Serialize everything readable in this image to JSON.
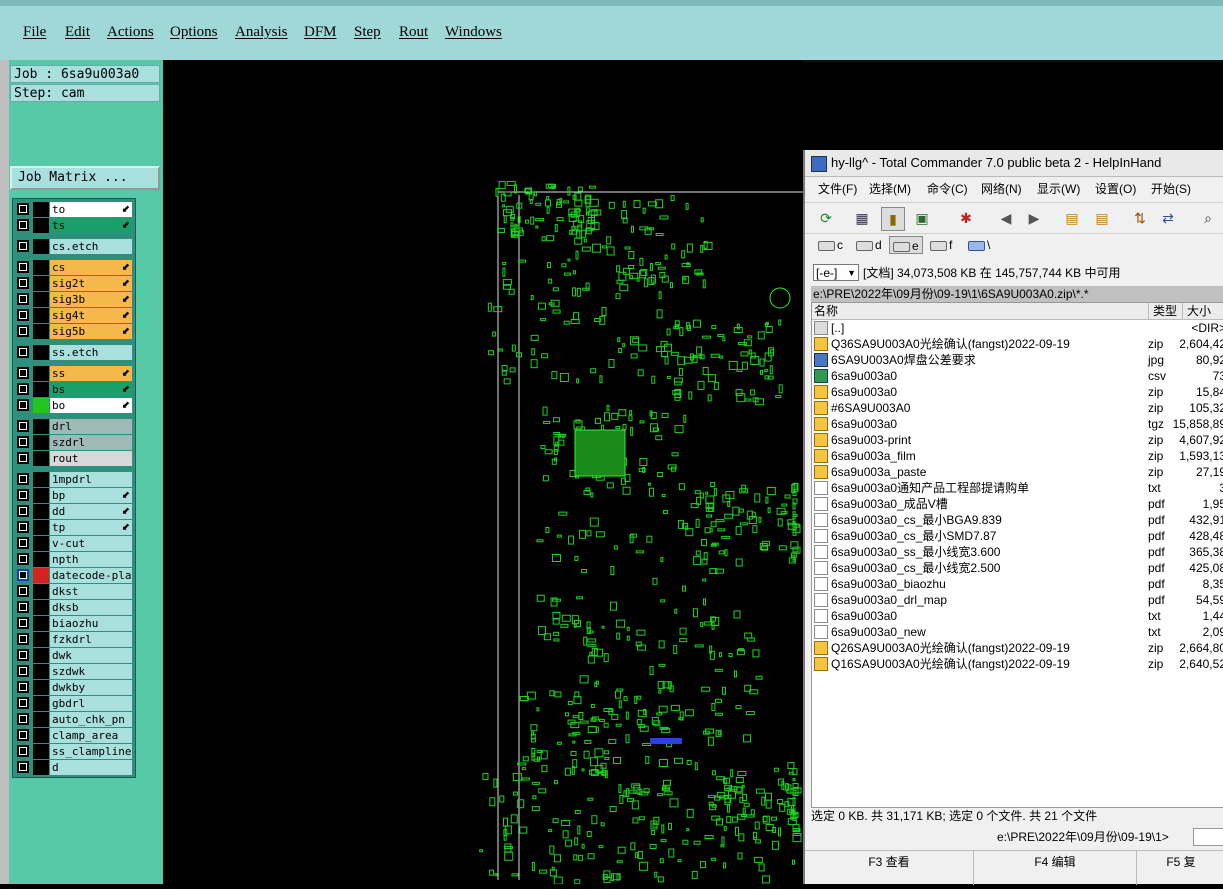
{
  "menubar": {
    "items": [
      "File",
      "Edit",
      "Actions",
      "Options",
      "Analysis",
      "DFM",
      "Step",
      "Rout",
      "Windows"
    ]
  },
  "left_panel": {
    "job_label": "Job : 6sa9u003a0",
    "step_label": "Step: cam",
    "job_matrix_button": "Job Matrix ...",
    "layers": [
      {
        "name": "to",
        "color": "#ffffff",
        "arrow": true
      },
      {
        "name": "ts",
        "color": "#1a9e6a",
        "arrow": true
      },
      {
        "name": "cs.etch",
        "color": "#a9dfdd",
        "arrow": false
      },
      {
        "name": "cs",
        "color": "#f5b84a",
        "arrow": true
      },
      {
        "name": "sig2t",
        "color": "#f5b84a",
        "arrow": true
      },
      {
        "name": "sig3b",
        "color": "#f5b84a",
        "arrow": true
      },
      {
        "name": "sig4t",
        "color": "#f5b84a",
        "arrow": true
      },
      {
        "name": "sig5b",
        "color": "#f5b84a",
        "arrow": true
      },
      {
        "name": "ss.etch",
        "color": "#a9dfdd",
        "arrow": false
      },
      {
        "name": "ss",
        "color": "#f5b84a",
        "arrow": true
      },
      {
        "name": "bs",
        "color": "#1a9e6a",
        "arrow": true
      },
      {
        "name": "bo",
        "color": "#ffffff",
        "arrow": true
      },
      {
        "name": "drl",
        "color": "#9fb8b8",
        "arrow": false
      },
      {
        "name": "szdrl",
        "color": "#9fb8b8",
        "arrow": false
      },
      {
        "name": "rout",
        "color": "#d8d8d8",
        "arrow": false
      },
      {
        "name": "1mpdrl",
        "color": "#a9dfdd",
        "arrow": false
      },
      {
        "name": "bp",
        "color": "#a9dfdd",
        "arrow": true
      },
      {
        "name": "dd",
        "color": "#a9dfdd",
        "arrow": true
      },
      {
        "name": "tp",
        "color": "#a9dfdd",
        "arrow": true
      },
      {
        "name": "v-cut",
        "color": "#a9dfdd",
        "arrow": false
      },
      {
        "name": "npth",
        "color": "#a9dfdd",
        "arrow": false
      },
      {
        "name": "datecode-pla",
        "color": "#a9dfdd",
        "arrow": false
      },
      {
        "name": "dkst",
        "color": "#a9dfdd",
        "arrow": false
      },
      {
        "name": "dksb",
        "color": "#a9dfdd",
        "arrow": false
      },
      {
        "name": "biaozhu",
        "color": "#a9dfdd",
        "arrow": false
      },
      {
        "name": "fzkdrl",
        "color": "#a9dfdd",
        "arrow": false
      },
      {
        "name": "dwk",
        "color": "#a9dfdd",
        "arrow": false
      },
      {
        "name": "szdwk",
        "color": "#a9dfdd",
        "arrow": false
      },
      {
        "name": "dwkby",
        "color": "#a9dfdd",
        "arrow": false
      },
      {
        "name": "gbdrl",
        "color": "#a9dfdd",
        "arrow": false
      },
      {
        "name": "auto_chk_pn",
        "color": "#a9dfdd",
        "arrow": false
      },
      {
        "name": "clamp_area",
        "color": "#a9dfdd",
        "arrow": false
      },
      {
        "name": "ss_clampline",
        "color": "#a9dfdd",
        "arrow": false
      },
      {
        "name": "d",
        "color": "#a9dfdd",
        "arrow": false
      }
    ]
  },
  "total_commander": {
    "title": "hy-llg^ - Total Commander 7.0 public beta 2 - HelpInHand",
    "menu": [
      "文件(F)",
      "选择(M)",
      "命令(C)",
      "网络(N)",
      "显示(W)",
      "设置(O)",
      "开始(S)"
    ],
    "drives": [
      "c",
      "d",
      "e",
      "f",
      "\\"
    ],
    "drive_select": "[-e-]",
    "free_space": "[文档]  34,073,508 KB 在 145,757,744 KB 中可用",
    "path": "e:\\PRE\\2022年\\09月份\\09-19\\1\\6SA9U003A0.zip\\*.*",
    "columns": {
      "name": "名称",
      "type": "类型",
      "size": "大小"
    },
    "files": [
      {
        "name": "[..]",
        "type": "",
        "size": "<DIR>",
        "icon": "up"
      },
      {
        "name": "Q36SA9U003A0光绘确认(fangst)2022-09-19",
        "type": "zip",
        "size": "2,604,42",
        "icon": "zip"
      },
      {
        "name": "6SA9U003A0焊盘公差要求",
        "type": "jpg",
        "size": "80,92",
        "icon": "img"
      },
      {
        "name": "6sa9u003a0",
        "type": "csv",
        "size": "73",
        "icon": "csv"
      },
      {
        "name": "6sa9u003a0",
        "type": "zip",
        "size": "15,84",
        "icon": "zip"
      },
      {
        "name": "#6SA9U003A0",
        "type": "zip",
        "size": "105,32",
        "icon": "zip"
      },
      {
        "name": "6sa9u003a0",
        "type": "tgz",
        "size": "15,858,89",
        "icon": "zip"
      },
      {
        "name": "6sa9u003-print",
        "type": "zip",
        "size": "4,607,92",
        "icon": "zip"
      },
      {
        "name": "6sa9u003a_film",
        "type": "zip",
        "size": "1,593,13",
        "icon": "zip"
      },
      {
        "name": "6sa9u003a_paste",
        "type": "zip",
        "size": "27,19",
        "icon": "zip"
      },
      {
        "name": "6sa9u003a0通知产品工程部提请购单",
        "type": "txt",
        "size": "3",
        "icon": "doc"
      },
      {
        "name": "6sa9u003a0_成品V槽",
        "type": "pdf",
        "size": "1,95",
        "icon": "doc"
      },
      {
        "name": "6sa9u003a0_cs_最小BGA9.839",
        "type": "pdf",
        "size": "432,91",
        "icon": "doc"
      },
      {
        "name": "6sa9u003a0_cs_最小SMD7.87",
        "type": "pdf",
        "size": "428,48",
        "icon": "doc"
      },
      {
        "name": "6sa9u003a0_ss_最小线宽3.600",
        "type": "pdf",
        "size": "365,38",
        "icon": "doc"
      },
      {
        "name": "6sa9u003a0_cs_最小线宽2.500",
        "type": "pdf",
        "size": "425,08",
        "icon": "doc"
      },
      {
        "name": "6sa9u003a0_biaozhu",
        "type": "pdf",
        "size": "8,35",
        "icon": "doc"
      },
      {
        "name": "6sa9u003a0_drl_map",
        "type": "pdf",
        "size": "54,59",
        "icon": "doc"
      },
      {
        "name": "6sa9u003a0",
        "type": "txt",
        "size": "1,44",
        "icon": "doc"
      },
      {
        "name": "6sa9u003a0_new",
        "type": "txt",
        "size": "2,09",
        "icon": "doc"
      },
      {
        "name": "Q26SA9U003A0光绘确认(fangst)2022-09-19",
        "type": "zip",
        "size": "2,664,80",
        "icon": "zip"
      },
      {
        "name": "Q16SA9U003A0光绘确认(fangst)2022-09-19",
        "type": "zip",
        "size": "2,640,52",
        "icon": "zip"
      }
    ],
    "status": "选定 0 KB. 共 31,171 KB; 选定 0 个文件. 共 21 个文件",
    "cmd_path": "e:\\PRE\\2022年\\09月份\\09-19\\1>",
    "fkeys": [
      "F3 查看",
      "F4 编辑",
      "F5 复"
    ]
  }
}
